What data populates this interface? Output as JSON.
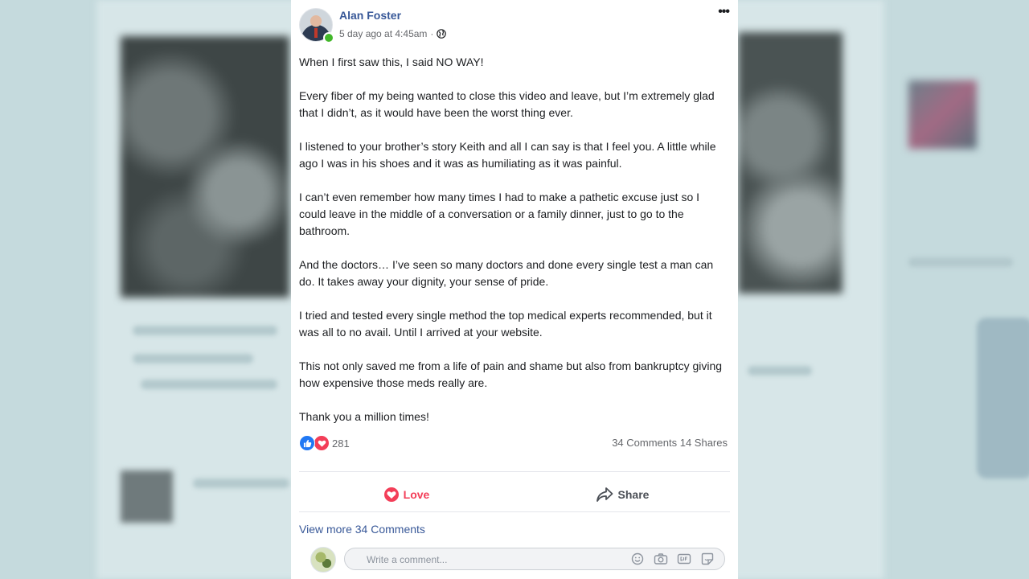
{
  "post": {
    "author": "Alan Foster",
    "timestamp": "5 day ago at 4:45am",
    "separator": "·",
    "privacy_icon": "globe-icon",
    "paragraphs": [
      "When I first saw this, I said NO WAY!",
      "Every fiber of my being wanted to close this video and leave, but I’m extremely glad that I didn’t, as it would have been the worst thing ever.",
      "I listened to your brother’s story Keith and all I can say is that I feel you. A little while ago I was in his shoes and it was as humiliating as it was painful.",
      "I can’t even remember how many times I had to make a pathetic excuse just so I could leave in the middle of a conversation or a family dinner, just to go to the bathroom.",
      "And the doctors… I’ve seen so many doctors and done every single test a man can do. It takes away your dignity, your sense of pride.",
      "I tried and tested every single method the top medical experts recommended, but it was all to no avail. Until I arrived at your website.",
      "This not only saved me from a life of pain and shame but also from bankruptcy giving how expensive those meds really are.",
      "Thank you a million times!"
    ],
    "reaction_count": "281",
    "comments_count": "34 Comments",
    "shares_count": "14 Shares"
  },
  "actions": {
    "love_label": "Love",
    "share_label": "Share"
  },
  "comments": {
    "view_more": "View more 34 Comments",
    "input_placeholder": "Write a comment..."
  },
  "colors": {
    "link": "#385898",
    "love": "#f33e58",
    "like": "#2078f4",
    "online": "#42b72a"
  }
}
